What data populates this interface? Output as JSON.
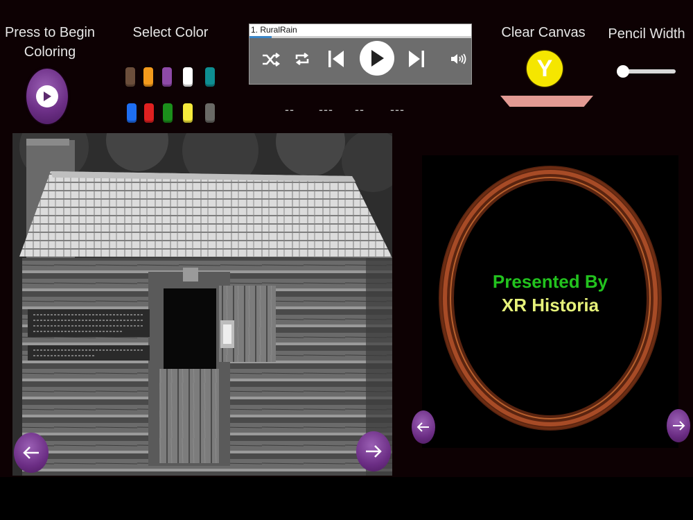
{
  "begin": {
    "label": "Press to Begin\nColoring"
  },
  "colors": {
    "label": "Select Color",
    "swatches": [
      "#6b4e3b",
      "#f29a1c",
      "#8e4aa8",
      "#ffffff",
      "#0e8e92",
      "#1e6ef2",
      "#e02020",
      "#1b8f1b",
      "#f5ea3c",
      "#6a6a66"
    ]
  },
  "player": {
    "track": "1.  RuralRain",
    "progress": 0.1,
    "icons": [
      "shuffle-icon",
      "repeat-icon",
      "previous-icon",
      "play-icon",
      "next-icon",
      "volume-icon"
    ]
  },
  "time": {
    "parts": [
      "--",
      "---",
      "--",
      "---"
    ]
  },
  "clear": {
    "label": "Clear Canvas",
    "key": "Y"
  },
  "pencil": {
    "label": "Pencil Width",
    "value": 0.05
  },
  "presenter": {
    "line1": "Presented By",
    "line2": "XR Historia"
  }
}
